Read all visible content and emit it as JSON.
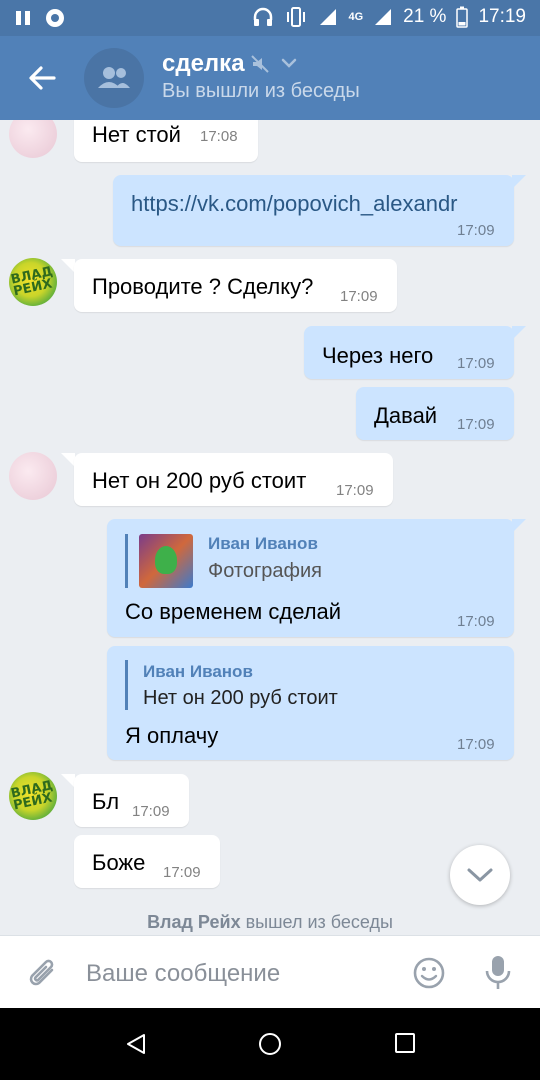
{
  "status_bar": {
    "battery": "21 %",
    "time": "17:19",
    "network": "4G"
  },
  "header": {
    "title": "сделка",
    "subtitle": "Вы вышли из беседы"
  },
  "messages": [
    {
      "text": "Нет стой",
      "time": "17:08"
    },
    {
      "text": "https://vk.com/popovich_alexandr",
      "time": "17:09"
    },
    {
      "text": "Проводите ? Сделку?",
      "time": "17:09"
    },
    {
      "text": "Через него",
      "time": "17:09"
    },
    {
      "text": "Давай",
      "time": "17:09"
    },
    {
      "text": "Нет он 200 руб стоит",
      "time": "17:09"
    },
    {
      "quote_name": "Иван Иванов",
      "quote_text": "Фотография",
      "text": "Со временем сделай",
      "time": "17:09"
    },
    {
      "quote_name": "Иван Иванов",
      "quote_text": "Нет он 200 руб стоит",
      "text": "Я оплачу",
      "time": "17:09"
    },
    {
      "text": "Бл",
      "time": "17:09"
    },
    {
      "text": "Боже",
      "time": "17:09"
    }
  ],
  "avatar_green_text": "ВЛАД РЕЙХ",
  "system_message": {
    "name": "Влад Рейх",
    "action": "вышел из беседы"
  },
  "composer": {
    "placeholder": "Ваше сообщение"
  },
  "colors": {
    "header": "#5181b8",
    "statusbar": "#4a76a8",
    "outgoing": "#cce4ff",
    "incoming": "#ffffff",
    "background": "#ebeef2"
  }
}
